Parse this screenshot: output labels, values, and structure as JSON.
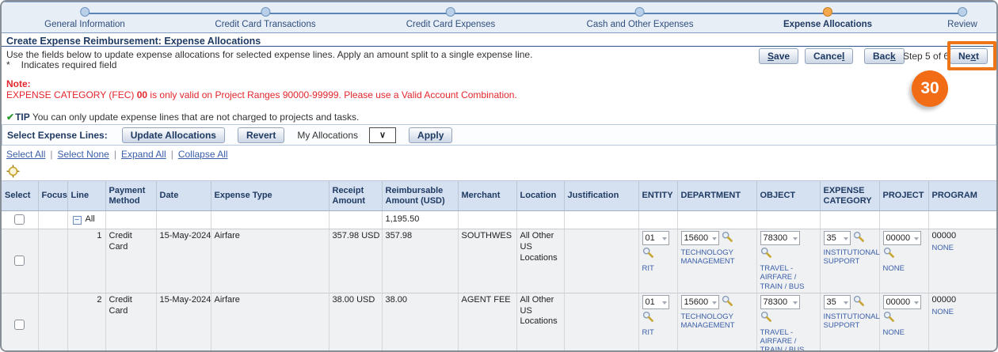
{
  "icons": {
    "checkmark": "✔",
    "collapse_minus": "−",
    "dropdown_chevron": "∨",
    "link_separator": "|",
    "required_marker": "*"
  },
  "colors": {
    "annotation_orange": "#F26B15",
    "train_current_orange": "#F3A84B",
    "link_blue": "#3A5EA8",
    "note_red": "#E2262C",
    "header_blue_bg": "#D5E1F0"
  },
  "train": {
    "steps": [
      {
        "label": "General Information",
        "state": "visited"
      },
      {
        "label": "Credit Card Transactions",
        "state": "visited"
      },
      {
        "label": "Credit Card Expenses",
        "state": "visited"
      },
      {
        "label": "Cash and Other Expenses",
        "state": "visited"
      },
      {
        "label": "Expense Allocations",
        "state": "current"
      },
      {
        "label": "Review",
        "state": "upcoming"
      }
    ]
  },
  "page": {
    "title": "Create Expense Reimbursement: Expense Allocations",
    "instruction": "Use the fields below to update expense allocations for selected expense lines. Apply an amount split to a single expense line.",
    "required_note": "Indicates required field",
    "step_indicator": "Step 5 of 6"
  },
  "nav_buttons": {
    "save": {
      "pre": "",
      "key": "S",
      "post": "ave"
    },
    "cancel": {
      "pre": "Cance",
      "key": "l",
      "post": ""
    },
    "back": {
      "pre": "Bac",
      "key": "k",
      "post": ""
    },
    "next": {
      "pre": "Ne",
      "key": "x",
      "post": "t"
    }
  },
  "note": {
    "label": "Note:",
    "text_before": "EXPENSE CATEGORY (FEC) ",
    "bold_value": "00",
    "text_after": " is only valid on Project Ranges 90000-99999. Please use a Valid Account Combination."
  },
  "tip": {
    "label": "TIP",
    "text": " You can only update expense lines that are not charged to projects and tasks."
  },
  "toolbar": {
    "label": "Select Expense Lines:",
    "update_allocations_button": "Update Allocations",
    "revert_button": "Revert",
    "my_allocations_label": "My Allocations",
    "apply_button": "Apply"
  },
  "links": {
    "select_all": "Select All",
    "select_none": "Select None",
    "expand_all": "Expand All",
    "collapse_all": "Collapse All"
  },
  "table": {
    "headers": {
      "select": "Select",
      "focus": "Focus",
      "line": "Line",
      "payment_method": "Payment Method",
      "date": "Date",
      "expense_type": "Expense Type",
      "receipt_amount": "Receipt Amount",
      "reimbursable_amount": "Reimbursable Amount (USD)",
      "merchant": "Merchant",
      "location": "Location",
      "justification": "Justification",
      "entity": "ENTITY",
      "department": "DEPARTMENT",
      "object": "OBJECT",
      "expense_category": "EXPENSE CATEGORY",
      "project": "PROJECT",
      "program": "PROGRAM"
    },
    "summary_row": {
      "line_label": "All",
      "reimbursable_amount": "1,195.50"
    },
    "rows": [
      {
        "line": "1",
        "payment_method": "Credit Card",
        "date": "15-May-2024",
        "expense_type": "Airfare",
        "receipt_amount": "357.98 USD",
        "reimbursable_amount": "357.98",
        "merchant": "SOUTHWES",
        "location": "All Other US Locations",
        "justification": "",
        "entity": {
          "value": "01",
          "description": "RIT"
        },
        "department": {
          "value": "15600",
          "description": "TECHNOLOGY MANAGEMENT"
        },
        "object": {
          "value": "78300",
          "description": "TRAVEL - AIRFARE / TRAIN / BUS"
        },
        "expense_category": {
          "value": "35",
          "description": "INSTITUTIONAL SUPPORT"
        },
        "project": {
          "value": "00000",
          "description": "NONE"
        },
        "program": {
          "value": "00000",
          "description": "NONE"
        }
      },
      {
        "line": "2",
        "payment_method": "Credit Card",
        "date": "15-May-2024",
        "expense_type": "Airfare",
        "receipt_amount": "38.00 USD",
        "reimbursable_amount": "38.00",
        "merchant": "AGENT FEE",
        "location": "All Other US Locations",
        "justification": "",
        "entity": {
          "value": "01",
          "description": "RIT"
        },
        "department": {
          "value": "15600",
          "description": "TECHNOLOGY MANAGEMENT"
        },
        "object": {
          "value": "78300",
          "description": "TRAVEL - AIRFARE / TRAIN / BUS"
        },
        "expense_category": {
          "value": "35",
          "description": "INSTITUTIONAL SUPPORT"
        },
        "project": {
          "value": "00000",
          "description": "NONE"
        },
        "program": {
          "value": "00000",
          "description": "NONE"
        }
      }
    ]
  },
  "annotation": {
    "badge_label": "30"
  }
}
